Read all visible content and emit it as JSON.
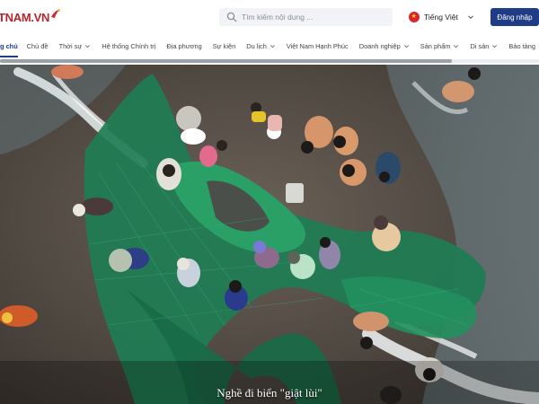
{
  "site": {
    "logo_text": "TNAM.VN"
  },
  "search": {
    "placeholder": "Tìm kiếm nội dung ..."
  },
  "language": {
    "label": "Tiếng Việt"
  },
  "header": {
    "login_label": "Đăng nhập"
  },
  "nav": {
    "items": [
      {
        "label": "g chủ",
        "has_dropdown": false,
        "active": true
      },
      {
        "label": "Chủ đề",
        "has_dropdown": false,
        "active": false
      },
      {
        "label": "Thời sự",
        "has_dropdown": true,
        "active": false
      },
      {
        "label": "Hệ thống Chính trị",
        "has_dropdown": false,
        "active": false
      },
      {
        "label": "Địa phương",
        "has_dropdown": false,
        "active": false
      },
      {
        "label": "Sự kiện",
        "has_dropdown": false,
        "active": false
      },
      {
        "label": "Du lịch",
        "has_dropdown": true,
        "active": false
      },
      {
        "label": "Việt Nam Hạnh Phúc",
        "has_dropdown": false,
        "active": false
      },
      {
        "label": "Doanh nghiệp",
        "has_dropdown": true,
        "active": false
      },
      {
        "label": "Sản phẩm",
        "has_dropdown": true,
        "active": false
      },
      {
        "label": "Di sản",
        "has_dropdown": true,
        "active": false
      },
      {
        "label": "Bảo tàng",
        "has_dropdown": false,
        "active": false
      }
    ]
  },
  "hero": {
    "caption": "Nghề đi biển \"giật lùi\""
  },
  "colors": {
    "brand_red": "#b3262d",
    "brand_blue": "#1f3d87",
    "net_green": "#1f8a5e"
  }
}
